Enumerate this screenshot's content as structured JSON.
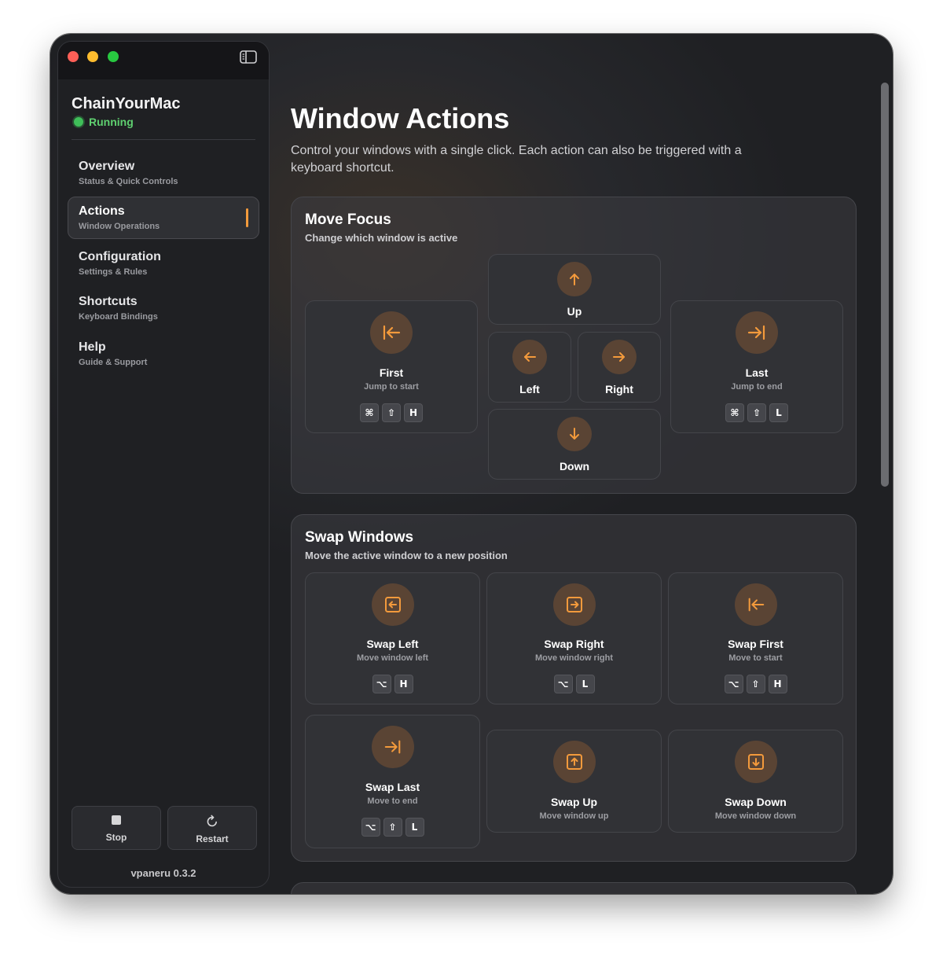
{
  "app": {
    "name": "ChainYourMac",
    "status": "Running",
    "version": "vpaneru 0.3.2"
  },
  "sidebar": {
    "items": [
      {
        "title": "Overview",
        "subtitle": "Status & Quick Controls"
      },
      {
        "title": "Actions",
        "subtitle": "Window Operations",
        "active": true
      },
      {
        "title": "Configuration",
        "subtitle": "Settings & Rules"
      },
      {
        "title": "Shortcuts",
        "subtitle": "Keyboard Bindings"
      },
      {
        "title": "Help",
        "subtitle": "Guide & Support"
      }
    ],
    "buttons": {
      "stop": "Stop",
      "restart": "Restart"
    }
  },
  "page": {
    "title": "Window Actions",
    "description": "Control your windows with a single click. Each action can also be triggered with a keyboard shortcut."
  },
  "move_focus": {
    "title": "Move Focus",
    "subtitle": "Change which window is active",
    "first": {
      "title": "First",
      "subtitle": "Jump to start",
      "keys": [
        "⌘",
        "⇧",
        "H"
      ],
      "icon": "arrow-to-start-icon"
    },
    "last": {
      "title": "Last",
      "subtitle": "Jump to end",
      "keys": [
        "⌘",
        "⇧",
        "L"
      ],
      "icon": "arrow-to-end-icon"
    },
    "up": {
      "title": "Up",
      "icon": "arrow-up-icon"
    },
    "left": {
      "title": "Left",
      "icon": "arrow-left-icon"
    },
    "right": {
      "title": "Right",
      "icon": "arrow-right-icon"
    },
    "down": {
      "title": "Down",
      "icon": "arrow-down-icon"
    }
  },
  "swap_windows": {
    "title": "Swap Windows",
    "subtitle": "Move the active window to a new position",
    "swap_left": {
      "title": "Swap Left",
      "subtitle": "Move window left",
      "keys": [
        "⌥",
        "H"
      ],
      "icon": "swap-left-icon"
    },
    "swap_right": {
      "title": "Swap Right",
      "subtitle": "Move window right",
      "keys": [
        "⌥",
        "L"
      ],
      "icon": "swap-right-icon"
    },
    "swap_first": {
      "title": "Swap First",
      "subtitle": "Move to start",
      "keys": [
        "⌥",
        "⇧",
        "H"
      ],
      "icon": "arrow-to-start-icon"
    },
    "swap_last": {
      "title": "Swap Last",
      "subtitle": "Move to end",
      "keys": [
        "⌥",
        "⇧",
        "L"
      ],
      "icon": "arrow-to-end-icon"
    },
    "swap_up": {
      "title": "Swap Up",
      "subtitle": "Move window up",
      "icon": "swap-up-icon"
    },
    "swap_down": {
      "title": "Swap Down",
      "subtitle": "Move window down",
      "icon": "swap-down-icon"
    }
  },
  "colors": {
    "accent": "#f39a3c",
    "running": "#3fbf59",
    "background": "#1f2023"
  }
}
